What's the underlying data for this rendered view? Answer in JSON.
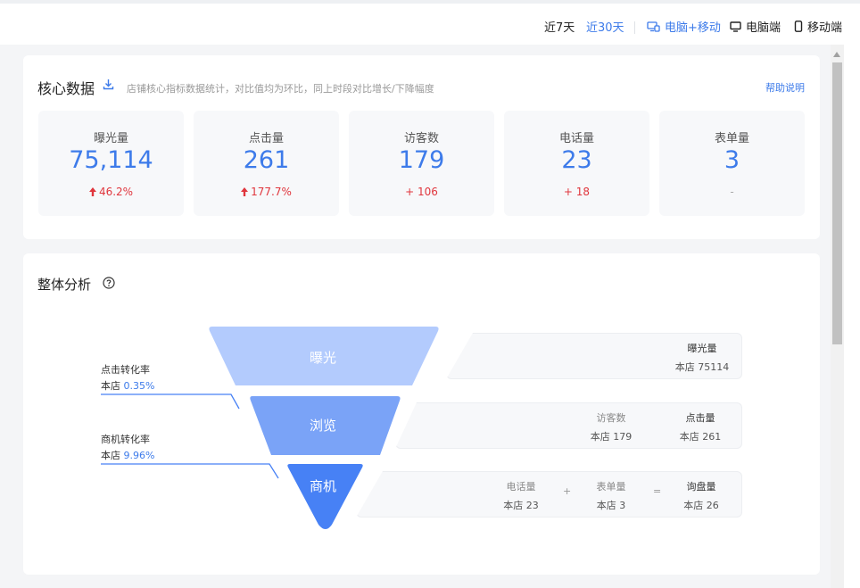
{
  "topbar": {
    "range_7": "近7天",
    "range_30": "近30天",
    "device_all": "电脑+移动",
    "device_pc": "电脑端",
    "device_mobile": "移动端"
  },
  "core": {
    "title": "核心数据",
    "desc": "店铺核心指标数据统计，对比值均为环比，同上时段对比增长/下降幅度",
    "help": "帮助说明",
    "metrics": [
      {
        "label": "曝光量",
        "value": "75,114",
        "change": "46.2%",
        "arrow": "up"
      },
      {
        "label": "点击量",
        "value": "261",
        "change": "177.7%",
        "arrow": "up"
      },
      {
        "label": "访客数",
        "value": "179",
        "change": "+ 106",
        "arrow": ""
      },
      {
        "label": "电话量",
        "value": "23",
        "change": "+ 18",
        "arrow": ""
      },
      {
        "label": "表单量",
        "value": "3",
        "change": "-",
        "arrow": ""
      }
    ]
  },
  "analysis": {
    "title": "整体分析",
    "funnel": [
      {
        "label": "曝光"
      },
      {
        "label": "浏览"
      },
      {
        "label": "商机"
      }
    ],
    "rates": [
      {
        "title": "点击转化率",
        "prefix": "本店",
        "value": "0.35%"
      },
      {
        "title": "商机转化率",
        "prefix": "本店",
        "value": "9.96%"
      }
    ],
    "boxes": {
      "exposure": {
        "title": "曝光量",
        "value": "本店 75114"
      },
      "browse": [
        {
          "title": "访客数",
          "value": "本店 179"
        },
        {
          "title": "点击量",
          "value": "本店 261"
        }
      ],
      "lead": [
        {
          "title": "电话量",
          "value": "本店 23"
        },
        {
          "title": "表单量",
          "value": "本店 3"
        },
        {
          "title": "询盘量",
          "value": "本店 26"
        }
      ],
      "op_plus": "+",
      "op_eq": "="
    }
  },
  "colors": {
    "accent": "#3d7bea",
    "up": "#e0363d",
    "funnel_top": "#b3cbfd",
    "funnel_mid": "#7aa3f7",
    "funnel_bottom": "#4781f5"
  }
}
